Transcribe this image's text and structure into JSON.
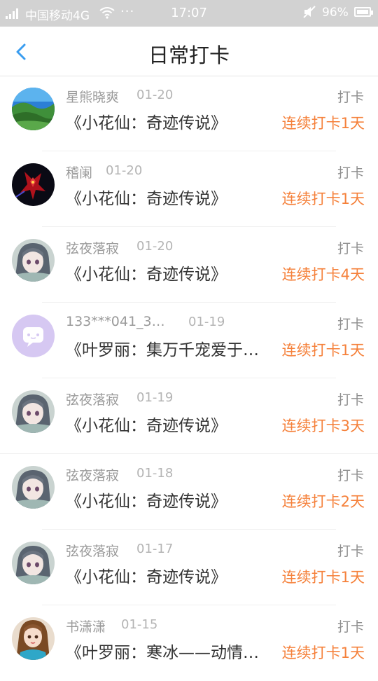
{
  "status_bar": {
    "carrier": "中国移动4G",
    "dots": "···",
    "time": "17:07",
    "battery": "96%"
  },
  "header": {
    "title": "日常打卡",
    "back_icon": "chevron-left-icon"
  },
  "colors": {
    "accent_blue": "#3a9df0",
    "streak_orange": "#f5813b",
    "status_bar_bg": "#d2d2d2"
  },
  "checkins": [
    {
      "user": "星熊晓爽",
      "date": "01-20",
      "action": "打卡",
      "book": "《小花仙：奇迹传说》",
      "streak": "连续打卡1天",
      "avatar": "landscape-avatar"
    },
    {
      "user": "稽阑",
      "date": "01-20",
      "action": "打卡",
      "book": "《小花仙：奇迹传说》",
      "streak": "连续打卡1天",
      "avatar": "red-mecha-avatar"
    },
    {
      "user": "弦夜落寂",
      "date": "01-20",
      "action": "打卡",
      "book": "《小花仙：奇迹传说》",
      "streak": "连续打卡4天",
      "avatar": "anime-girl-avatar"
    },
    {
      "user": "133***041_3…",
      "date": "01-19",
      "action": "打卡",
      "book": "《叶罗丽：集万千宠爱于…",
      "streak": "连续打卡1天",
      "avatar": "chat-bubble-avatar"
    },
    {
      "user": "弦夜落寂",
      "date": "01-19",
      "action": "打卡",
      "book": "《小花仙：奇迹传说》",
      "streak": "连续打卡3天",
      "avatar": "anime-girl-avatar"
    },
    {
      "user": "弦夜落寂",
      "date": "01-18",
      "action": "打卡",
      "book": "《小花仙：奇迹传说》",
      "streak": "连续打卡2天",
      "avatar": "anime-girl-avatar"
    },
    {
      "user": "弦夜落寂",
      "date": "01-17",
      "action": "打卡",
      "book": "《小花仙：奇迹传说》",
      "streak": "连续打卡1天",
      "avatar": "anime-girl-avatar"
    },
    {
      "user": "书潇潇",
      "date": "01-15",
      "action": "打卡",
      "book": "《叶罗丽：寒冰——动情…",
      "streak": "连续打卡1天",
      "avatar": "doll-avatar"
    }
  ]
}
